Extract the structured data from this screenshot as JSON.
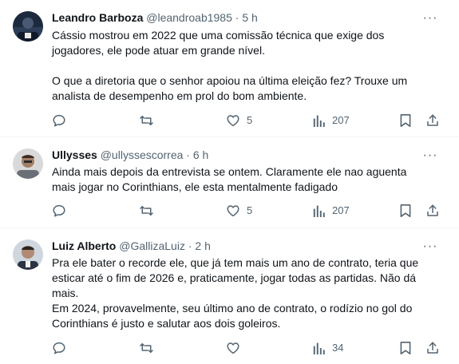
{
  "tweets": [
    {
      "name": "Leandro Barboza",
      "handle": "@leandroab1985",
      "dot": "·",
      "time": "5 h",
      "more": "···",
      "paragraphs": [
        "Cássio mostrou em 2022 que uma comissão técnica que exige dos jogadores, ele pode atuar em grande nível.",
        "O que a diretoria que o senhor apoiou na última eleição fez? Trouxe um analista de desempenho em prol do bom ambiente."
      ],
      "likes": "5",
      "views": "207"
    },
    {
      "name": "Ullysses",
      "handle": "@ullyssescorrea",
      "dot": "·",
      "time": "6 h",
      "more": "···",
      "paragraphs": [
        "Ainda mais depois da entrevista se ontem. Claramente ele nao aguenta mais jogar no Corinthians, ele esta mentalmente fadigado"
      ],
      "likes": "5",
      "views": "207"
    },
    {
      "name": "Luiz Alberto",
      "handle": "@GallizaLuiz",
      "dot": "·",
      "time": "2 h",
      "more": "···",
      "paragraphs": [
        "Pra ele bater o recorde ele, que já tem mais um ano de contrato, teria que esticar até o fim de 2026 e, praticamente, jogar todas as partidas. Não dá mais.",
        "Em 2024, provavelmente, seu último ano de contrato, o rodízio no gol do Corinthians é justo e salutar aos dois goleiros."
      ],
      "likes": "",
      "views": "34"
    }
  ],
  "colors": {
    "text": "#0f1419",
    "muted": "#536471",
    "divider": "#eff3f4"
  },
  "icons": [
    "reply-icon",
    "retweet-icon",
    "like-icon",
    "views-icon",
    "bookmark-icon",
    "share-icon",
    "more-icon"
  ]
}
